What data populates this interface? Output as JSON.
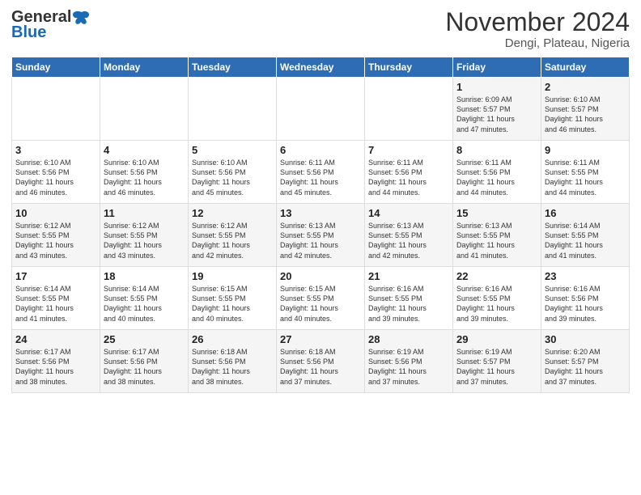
{
  "logo": {
    "general": "General",
    "blue": "Blue"
  },
  "header": {
    "month": "November 2024",
    "location": "Dengi, Plateau, Nigeria"
  },
  "weekdays": [
    "Sunday",
    "Monday",
    "Tuesday",
    "Wednesday",
    "Thursday",
    "Friday",
    "Saturday"
  ],
  "weeks": [
    [
      {
        "day": "",
        "info": ""
      },
      {
        "day": "",
        "info": ""
      },
      {
        "day": "",
        "info": ""
      },
      {
        "day": "",
        "info": ""
      },
      {
        "day": "",
        "info": ""
      },
      {
        "day": "1",
        "info": "Sunrise: 6:09 AM\nSunset: 5:57 PM\nDaylight: 11 hours\nand 47 minutes."
      },
      {
        "day": "2",
        "info": "Sunrise: 6:10 AM\nSunset: 5:57 PM\nDaylight: 11 hours\nand 46 minutes."
      }
    ],
    [
      {
        "day": "3",
        "info": "Sunrise: 6:10 AM\nSunset: 5:56 PM\nDaylight: 11 hours\nand 46 minutes."
      },
      {
        "day": "4",
        "info": "Sunrise: 6:10 AM\nSunset: 5:56 PM\nDaylight: 11 hours\nand 46 minutes."
      },
      {
        "day": "5",
        "info": "Sunrise: 6:10 AM\nSunset: 5:56 PM\nDaylight: 11 hours\nand 45 minutes."
      },
      {
        "day": "6",
        "info": "Sunrise: 6:11 AM\nSunset: 5:56 PM\nDaylight: 11 hours\nand 45 minutes."
      },
      {
        "day": "7",
        "info": "Sunrise: 6:11 AM\nSunset: 5:56 PM\nDaylight: 11 hours\nand 44 minutes."
      },
      {
        "day": "8",
        "info": "Sunrise: 6:11 AM\nSunset: 5:56 PM\nDaylight: 11 hours\nand 44 minutes."
      },
      {
        "day": "9",
        "info": "Sunrise: 6:11 AM\nSunset: 5:55 PM\nDaylight: 11 hours\nand 44 minutes."
      }
    ],
    [
      {
        "day": "10",
        "info": "Sunrise: 6:12 AM\nSunset: 5:55 PM\nDaylight: 11 hours\nand 43 minutes."
      },
      {
        "day": "11",
        "info": "Sunrise: 6:12 AM\nSunset: 5:55 PM\nDaylight: 11 hours\nand 43 minutes."
      },
      {
        "day": "12",
        "info": "Sunrise: 6:12 AM\nSunset: 5:55 PM\nDaylight: 11 hours\nand 42 minutes."
      },
      {
        "day": "13",
        "info": "Sunrise: 6:13 AM\nSunset: 5:55 PM\nDaylight: 11 hours\nand 42 minutes."
      },
      {
        "day": "14",
        "info": "Sunrise: 6:13 AM\nSunset: 5:55 PM\nDaylight: 11 hours\nand 42 minutes."
      },
      {
        "day": "15",
        "info": "Sunrise: 6:13 AM\nSunset: 5:55 PM\nDaylight: 11 hours\nand 41 minutes."
      },
      {
        "day": "16",
        "info": "Sunrise: 6:14 AM\nSunset: 5:55 PM\nDaylight: 11 hours\nand 41 minutes."
      }
    ],
    [
      {
        "day": "17",
        "info": "Sunrise: 6:14 AM\nSunset: 5:55 PM\nDaylight: 11 hours\nand 41 minutes."
      },
      {
        "day": "18",
        "info": "Sunrise: 6:14 AM\nSunset: 5:55 PM\nDaylight: 11 hours\nand 40 minutes."
      },
      {
        "day": "19",
        "info": "Sunrise: 6:15 AM\nSunset: 5:55 PM\nDaylight: 11 hours\nand 40 minutes."
      },
      {
        "day": "20",
        "info": "Sunrise: 6:15 AM\nSunset: 5:55 PM\nDaylight: 11 hours\nand 40 minutes."
      },
      {
        "day": "21",
        "info": "Sunrise: 6:16 AM\nSunset: 5:55 PM\nDaylight: 11 hours\nand 39 minutes."
      },
      {
        "day": "22",
        "info": "Sunrise: 6:16 AM\nSunset: 5:55 PM\nDaylight: 11 hours\nand 39 minutes."
      },
      {
        "day": "23",
        "info": "Sunrise: 6:16 AM\nSunset: 5:56 PM\nDaylight: 11 hours\nand 39 minutes."
      }
    ],
    [
      {
        "day": "24",
        "info": "Sunrise: 6:17 AM\nSunset: 5:56 PM\nDaylight: 11 hours\nand 38 minutes."
      },
      {
        "day": "25",
        "info": "Sunrise: 6:17 AM\nSunset: 5:56 PM\nDaylight: 11 hours\nand 38 minutes."
      },
      {
        "day": "26",
        "info": "Sunrise: 6:18 AM\nSunset: 5:56 PM\nDaylight: 11 hours\nand 38 minutes."
      },
      {
        "day": "27",
        "info": "Sunrise: 6:18 AM\nSunset: 5:56 PM\nDaylight: 11 hours\nand 37 minutes."
      },
      {
        "day": "28",
        "info": "Sunrise: 6:19 AM\nSunset: 5:56 PM\nDaylight: 11 hours\nand 37 minutes."
      },
      {
        "day": "29",
        "info": "Sunrise: 6:19 AM\nSunset: 5:57 PM\nDaylight: 11 hours\nand 37 minutes."
      },
      {
        "day": "30",
        "info": "Sunrise: 6:20 AM\nSunset: 5:57 PM\nDaylight: 11 hours\nand 37 minutes."
      }
    ]
  ]
}
